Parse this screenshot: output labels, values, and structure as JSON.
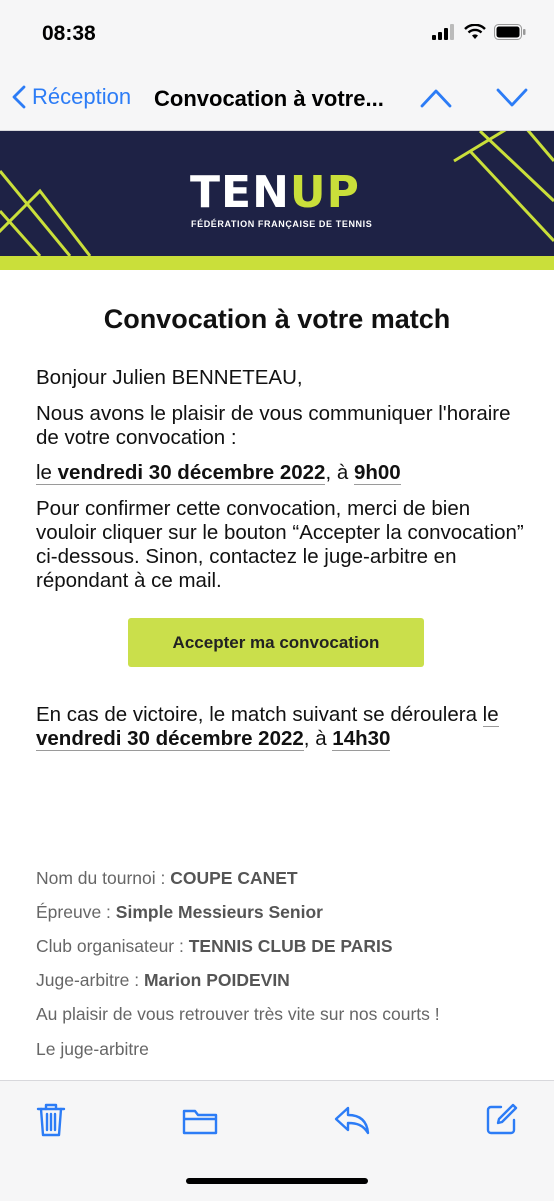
{
  "status_bar": {
    "time": "08:38"
  },
  "nav": {
    "back_label": "Réception",
    "subject": "Convocation à votre..."
  },
  "banner": {
    "logo_part1": "TEN",
    "logo_part2": "UP",
    "tagline": "FÉDÉRATION FRANÇAISE DE TENNIS"
  },
  "email": {
    "title": "Convocation à votre match",
    "greeting": "Bonjour Julien BENNETEAU,",
    "intro": "Nous avons le plaisir de vous communiquer l'horaire de votre convocation :",
    "convocation": {
      "prefix": "le ",
      "date": "vendredi  30 décembre  2022",
      "sep": ", à ",
      "time": "9h00"
    },
    "instructions": "Pour confirmer cette convocation, merci de bien vouloir cliquer sur le bouton “Accepter la convocation” ci-dessous. Sinon, contactez le juge-arbitre en répondant à ce mail.",
    "accept_button": "Accepter ma convocation",
    "next_match": {
      "prefix": "En cas de victoire, le match suivant se déroulera ",
      "le": "le ",
      "date": "vendredi 30 décembre 2022",
      "sep": ", à ",
      "time": "14h30"
    },
    "details": [
      {
        "label": "Nom du tournoi : ",
        "value": "COUPE CANET"
      },
      {
        "label": "Épreuve : ",
        "value": "Simple Messieurs Senior"
      },
      {
        "label": "Club organisateur : ",
        "value": "TENNIS CLUB DE PARIS"
      },
      {
        "label": "Juge-arbitre : ",
        "value": "Marion POIDEVIN"
      }
    ],
    "closing": "Au plaisir de vous retrouver très vite sur nos courts !",
    "signature": "Le juge-arbitre"
  },
  "colors": {
    "accent": "#2c7cf6",
    "navy": "#1e2245",
    "lime": "#cadf3a"
  }
}
